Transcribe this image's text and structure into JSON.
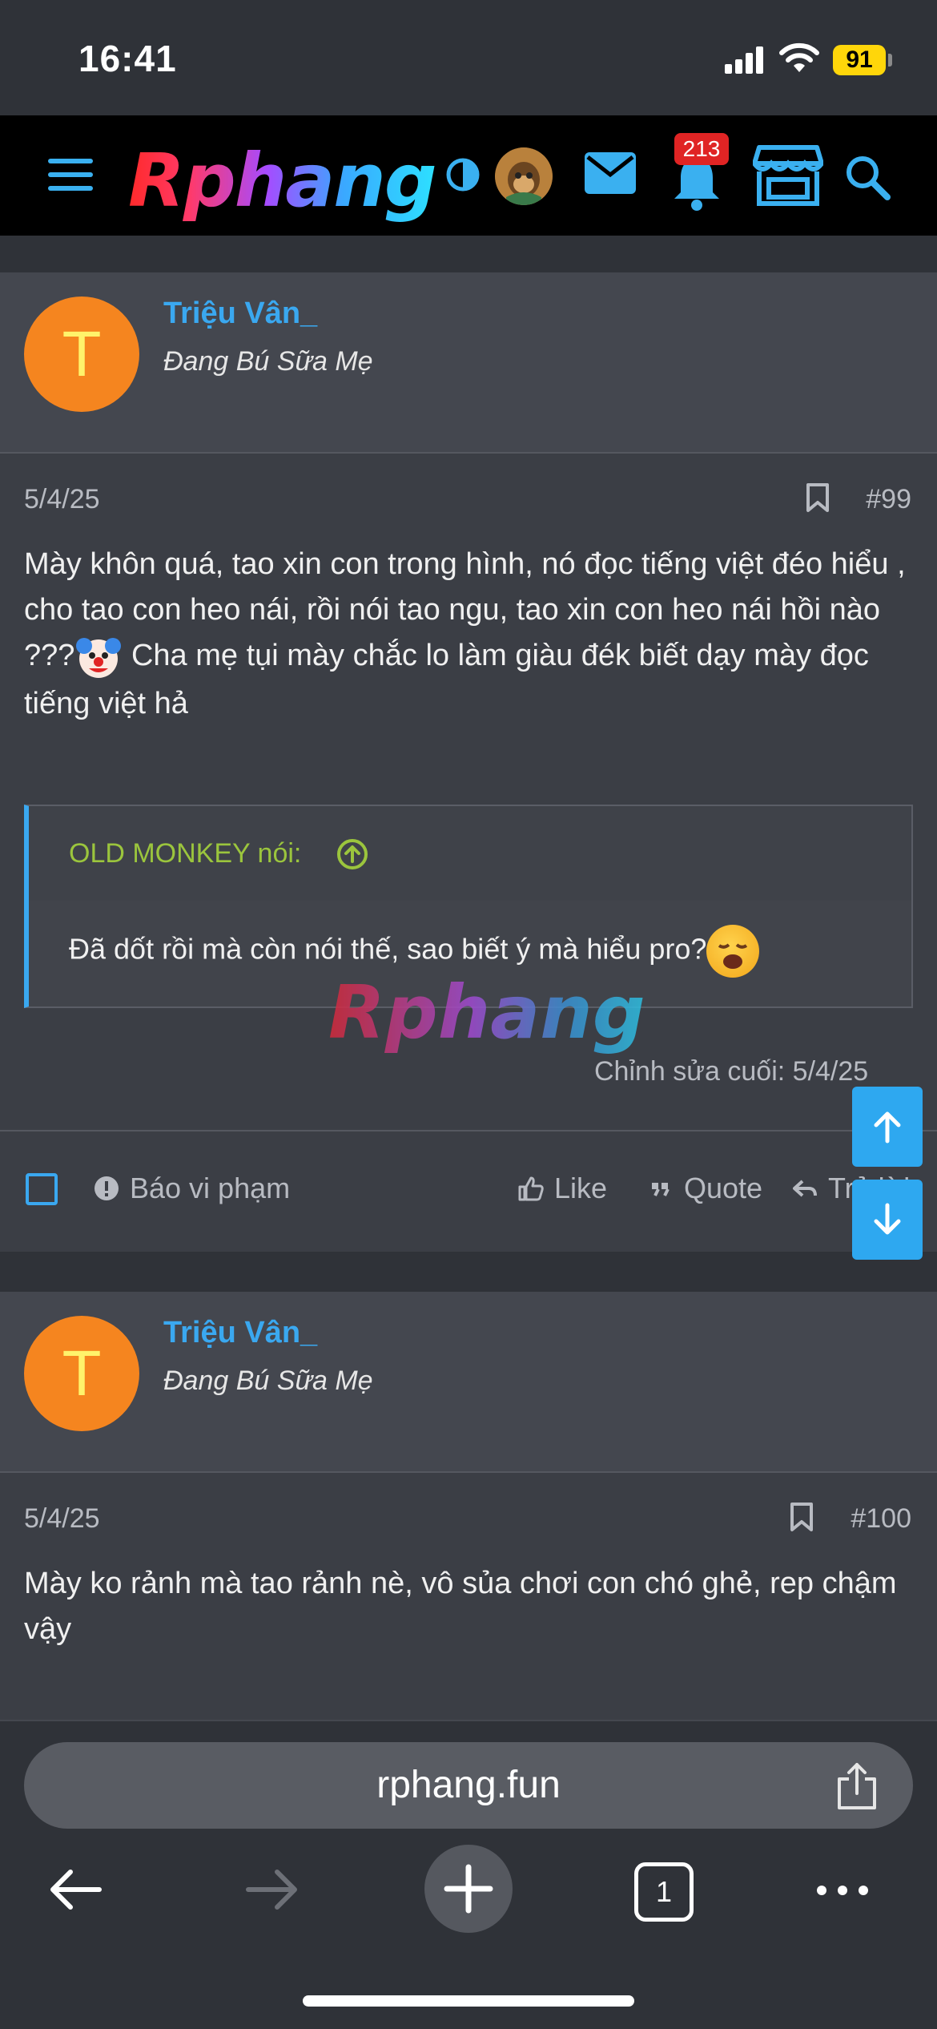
{
  "status": {
    "time": "16:41",
    "battery": "91"
  },
  "nav": {
    "logo": "Rphang",
    "notif_count": "213"
  },
  "posts": [
    {
      "username": "Triệu Vân_",
      "usertitle": "Đang Bú Sữa Mẹ",
      "avatar_letter": "T",
      "date": "5/4/25",
      "number": "#99",
      "text_a": "Mày khôn quá, tao xin con trong hình, nó đọc tiếng việt đéo hiểu , cho tao con heo nái, rồi nói tao ngu, tao xin con heo nái hồi nào ???",
      "text_b": " Cha mẹ tụi mày chắc lo làm giàu đék biết dạy mày đọc tiếng việt hả",
      "quote_author": "OLD MONKEY nói:",
      "quote_text": "Đã dốt rồi mà còn nói thế, sao biết ý mà hiểu pro?",
      "edited": "Chỉnh sửa cuối: 5/4/25",
      "actions": {
        "report": "Báo vi phạm",
        "like": "Like",
        "quote": "Quote",
        "reply": "Trả lời"
      }
    },
    {
      "username": "Triệu Vân_",
      "usertitle": "Đang Bú Sữa Mẹ",
      "avatar_letter": "T",
      "date": "5/4/25",
      "number": "#100",
      "text": "Mày ko rảnh mà tao rảnh nè, vô sủa chơi con chó ghẻ, rep chậm vậy"
    }
  ],
  "watermark": "Rphang",
  "browser": {
    "url": "rphang.fun",
    "tab_count": "1"
  },
  "colors": {
    "accent": "#3aa8f0",
    "quote_author": "#9bc53d",
    "avatar_bg": "#f5851f",
    "badge": "#e02424"
  }
}
